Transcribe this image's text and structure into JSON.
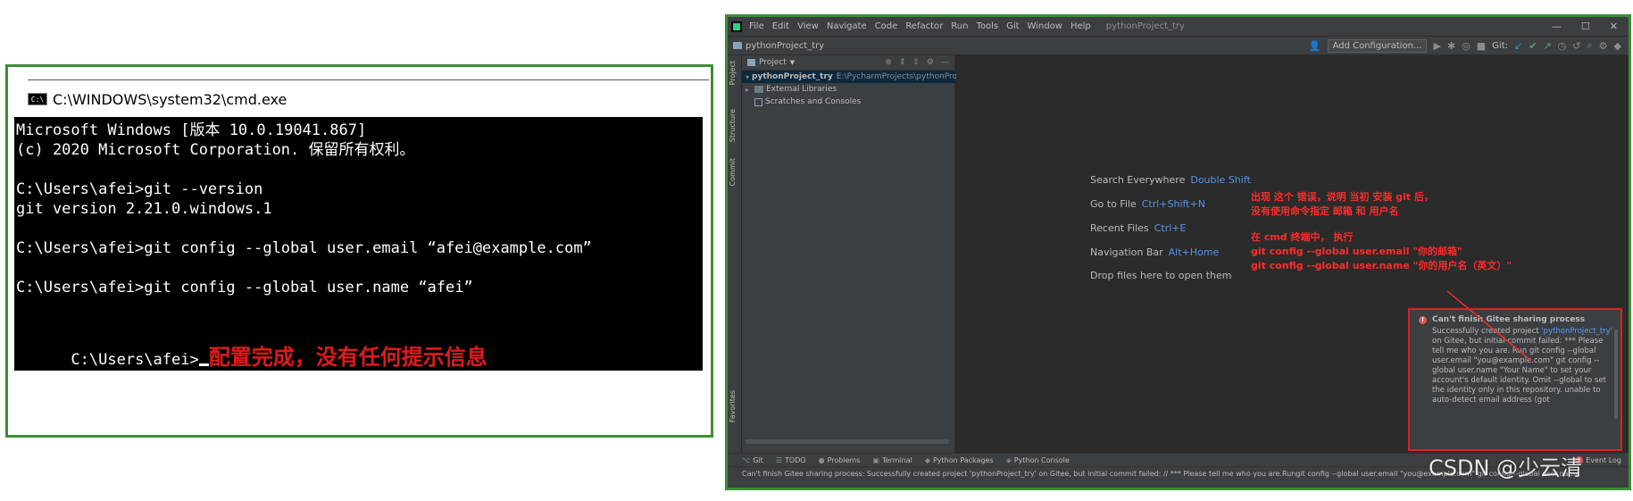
{
  "cmd": {
    "title": "C:\\WINDOWS\\system32\\cmd.exe",
    "icon_text": "C:\\",
    "lines": [
      "Microsoft Windows [版本 10.0.19041.867]",
      "(c) 2020 Microsoft Corporation. 保留所有权利。",
      "",
      "C:\\Users\\afei>git --version",
      "git version 2.21.0.windows.1",
      "",
      "C:\\Users\\afei>git config --global user.email “afei@example.com”",
      "",
      "C:\\Users\\afei>git config --global user.name “afei”",
      ""
    ],
    "prompt": "C:\\Users\\afei>",
    "note": "配置完成，没有任何提示信息"
  },
  "ide": {
    "menu": [
      "File",
      "Edit",
      "View",
      "Navigate",
      "Code",
      "Refactor",
      "Run",
      "Tools",
      "Git",
      "Window",
      "Help"
    ],
    "window_title": "pythonProject_try",
    "window_controls": [
      "—",
      "☐",
      "✕"
    ],
    "breadcrumb": "pythonProject_try",
    "add_config_label": "Add Configuration...",
    "git_label": "Git:",
    "side_tabs": [
      "Project",
      "Structure",
      "Commit",
      "Favorites"
    ],
    "project_panel": {
      "title": "Project",
      "tree": [
        {
          "label": "pythonProject_try",
          "path": "E:\\PycharmProjects\\pythonProject",
          "selected": true,
          "kind": "folder",
          "arrow": "▾"
        },
        {
          "label": "External Libraries",
          "path": "",
          "selected": false,
          "kind": "lib",
          "arrow": "▸"
        },
        {
          "label": "Scratches and Consoles",
          "path": "",
          "selected": false,
          "kind": "scratch",
          "arrow": ""
        }
      ]
    },
    "hints": [
      {
        "text": "Search Everywhere",
        "key": "Double Shift"
      },
      {
        "text": "Go to File",
        "key": "Ctrl+Shift+N"
      },
      {
        "text": "Recent Files",
        "key": "Ctrl+E"
      },
      {
        "text": "Navigation Bar",
        "key": "Alt+Home"
      },
      {
        "text": "Drop files here to open them",
        "key": ""
      }
    ],
    "annotations": {
      "line1": "出现 这个 错误，说明 当初 安装 git 后，",
      "line2": "没有使用命令指定 邮箱 和 用户名",
      "line3": "在 cmd 终端中， 执行",
      "line4": "git config --global user.email \"你的邮箱\"",
      "line5": "git config --global user.name \"你的用户名（英文）\""
    },
    "notification": {
      "title": "Can't finish Gitee sharing process",
      "body_pre": "Successfully created project",
      "link": "'pythonProject_try'",
      "body_post": "on Gitee, but initial commit failed: *** Please tell me who you are. Run git config --global user.email \"you@example.com\" git config --global user.name \"Your Name\" to set your account's default identity. Omit --global to set the identity only in this repository. unable to auto-detect email address (got"
    },
    "bottom_tabs": [
      {
        "icon": "⌥",
        "label": "Git"
      },
      {
        "icon": "☰",
        "label": "TODO"
      },
      {
        "icon": "●",
        "label": "Problems"
      },
      {
        "icon": "▣",
        "label": "Terminal"
      },
      {
        "icon": "◆",
        "label": "Python Packages"
      },
      {
        "icon": "◈",
        "label": "Python Console"
      }
    ],
    "event_log": "Event Log",
    "event_badge": "1",
    "status": "Can't finish Gitee sharing process: Successfully created project 'pythonProject_try' on Gitee, but initial commit failed: // *** Please tell me who you are.Rungit config --global user.email \"you@example.com\" git config --global user.name"
  },
  "watermark": "CSDN @少云清",
  "colors": {
    "frame_green": "#3e8e36",
    "annotation_red": "#ff2a2a",
    "link_blue": "#589df6"
  }
}
